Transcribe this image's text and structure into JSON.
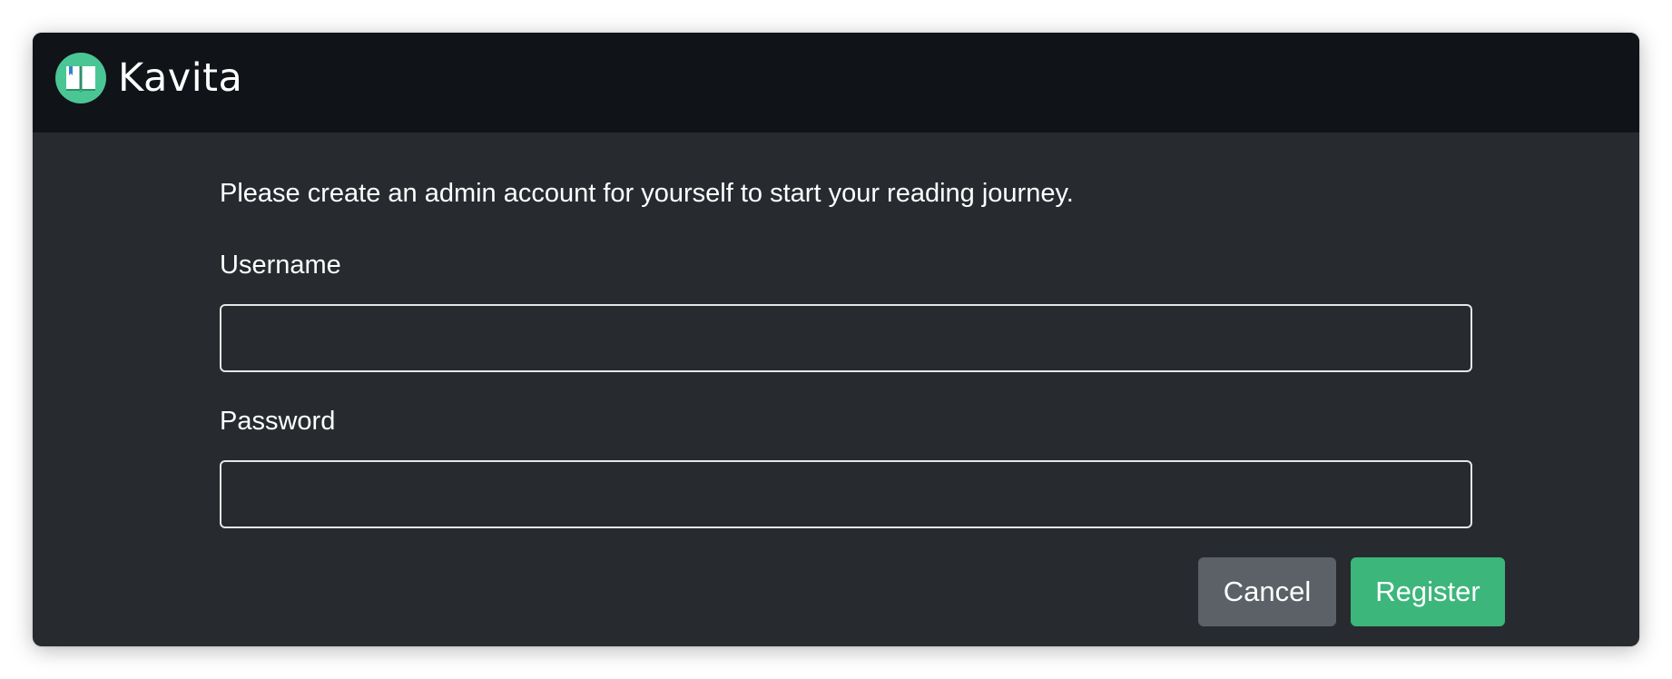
{
  "app": {
    "name": "Kavita",
    "logo_icon": "open-book-icon",
    "brand_color": "#4ac694"
  },
  "register_form": {
    "intro_text": "Please create an admin account for yourself to start your reading journey.",
    "username_label": "Username",
    "username_value": "",
    "password_label": "Password",
    "password_value": "",
    "cancel_label": "Cancel",
    "register_label": "Register"
  },
  "colors": {
    "navbar_bg": "#101317",
    "page_bg": "#272b30",
    "cancel_button": "#5b6167",
    "register_button": "#3cb67b"
  }
}
